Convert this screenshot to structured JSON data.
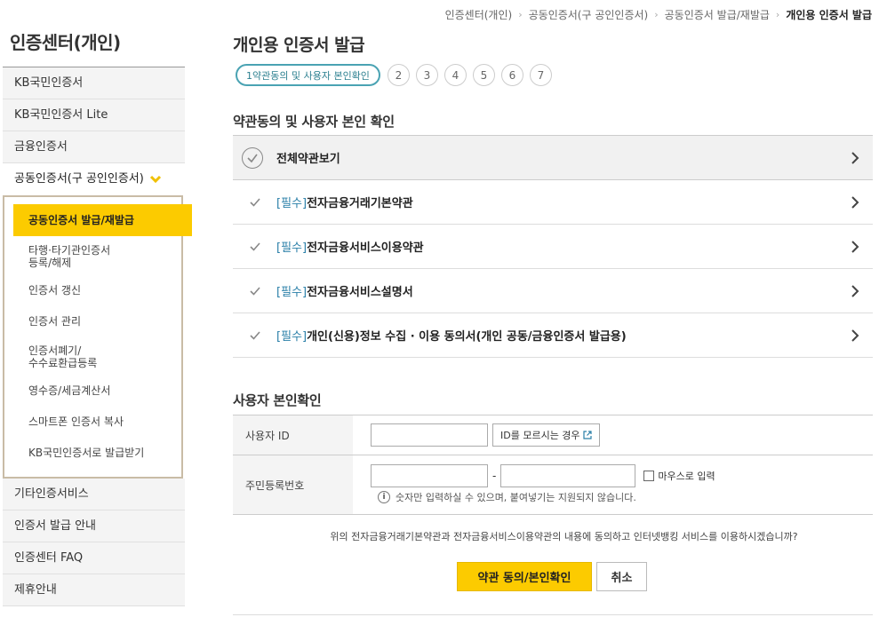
{
  "breadcrumb": [
    "인증센터(개인)",
    "공동인증서(구 공인인증서)",
    "공동인증서 발급/재발급",
    "개인용 인증서 발급"
  ],
  "sidebar": {
    "title": "인증센터(개인)",
    "items_top": [
      "KB국민인증서",
      "KB국민인증서 Lite",
      "금융인증서"
    ],
    "open_item": "공동인증서(구 공인인증서)",
    "submenu": [
      "공동인증서 발급/재발급",
      "타행·타기관인증서",
      "등록/해제",
      "인증서 갱신",
      "인증서 관리",
      "인증서폐기/",
      "수수료환급등록",
      "영수증/세금계산서",
      "스마트폰 인증서 복사",
      "KB국민인증서로 발급받기"
    ],
    "items_bottom": [
      "기타인증서비스",
      "인증서 발급 안내",
      "인증센터 FAQ",
      "제휴안내"
    ]
  },
  "page": {
    "title": "개인용 인증서 발급",
    "steps": [
      "1약관동의 및 사용자 본인확인",
      "2",
      "3",
      "4",
      "5",
      "6",
      "7"
    ]
  },
  "terms": {
    "section_title": "약관동의 및 사용자 본인 확인",
    "all_label": "전체약관보기",
    "required_tag": "[필수]",
    "items": [
      "전자금융거래기본약관",
      "전자금융서비스이용약관",
      "전자금융서비스설명서",
      "개인(신용)정보 수집 · 이용 동의서(개인 공동/금융인증서 발급용)"
    ]
  },
  "identity": {
    "section_title": "사용자 본인확인",
    "user_id_label": "사용자 ID",
    "user_id_value": "",
    "find_id_button": "ID를 모르시는 경우",
    "rrn_label": "주민등록번호",
    "rrn_front": "",
    "rrn_separator": "-",
    "rrn_back": "",
    "mouse_input_label": "마우스로 입력",
    "hint": "숫자만 입력하실 수 있으며, 붙여넣기는 지원되지 않습니다.",
    "info_glyph": "i"
  },
  "confirm": {
    "question": "위의 전자금융거래기본약관과 전자금융서비스이용약관의 내용에 동의하고 인터넷뱅킹 서비스를 이용하시겠습니까?",
    "agree_button": "약관 동의/본인확인",
    "cancel_button": "취소"
  },
  "colors": {
    "accent_yellow": "#fccb00",
    "step_teal": "#4aa3b3",
    "required_blue": "#2a7fa8"
  }
}
